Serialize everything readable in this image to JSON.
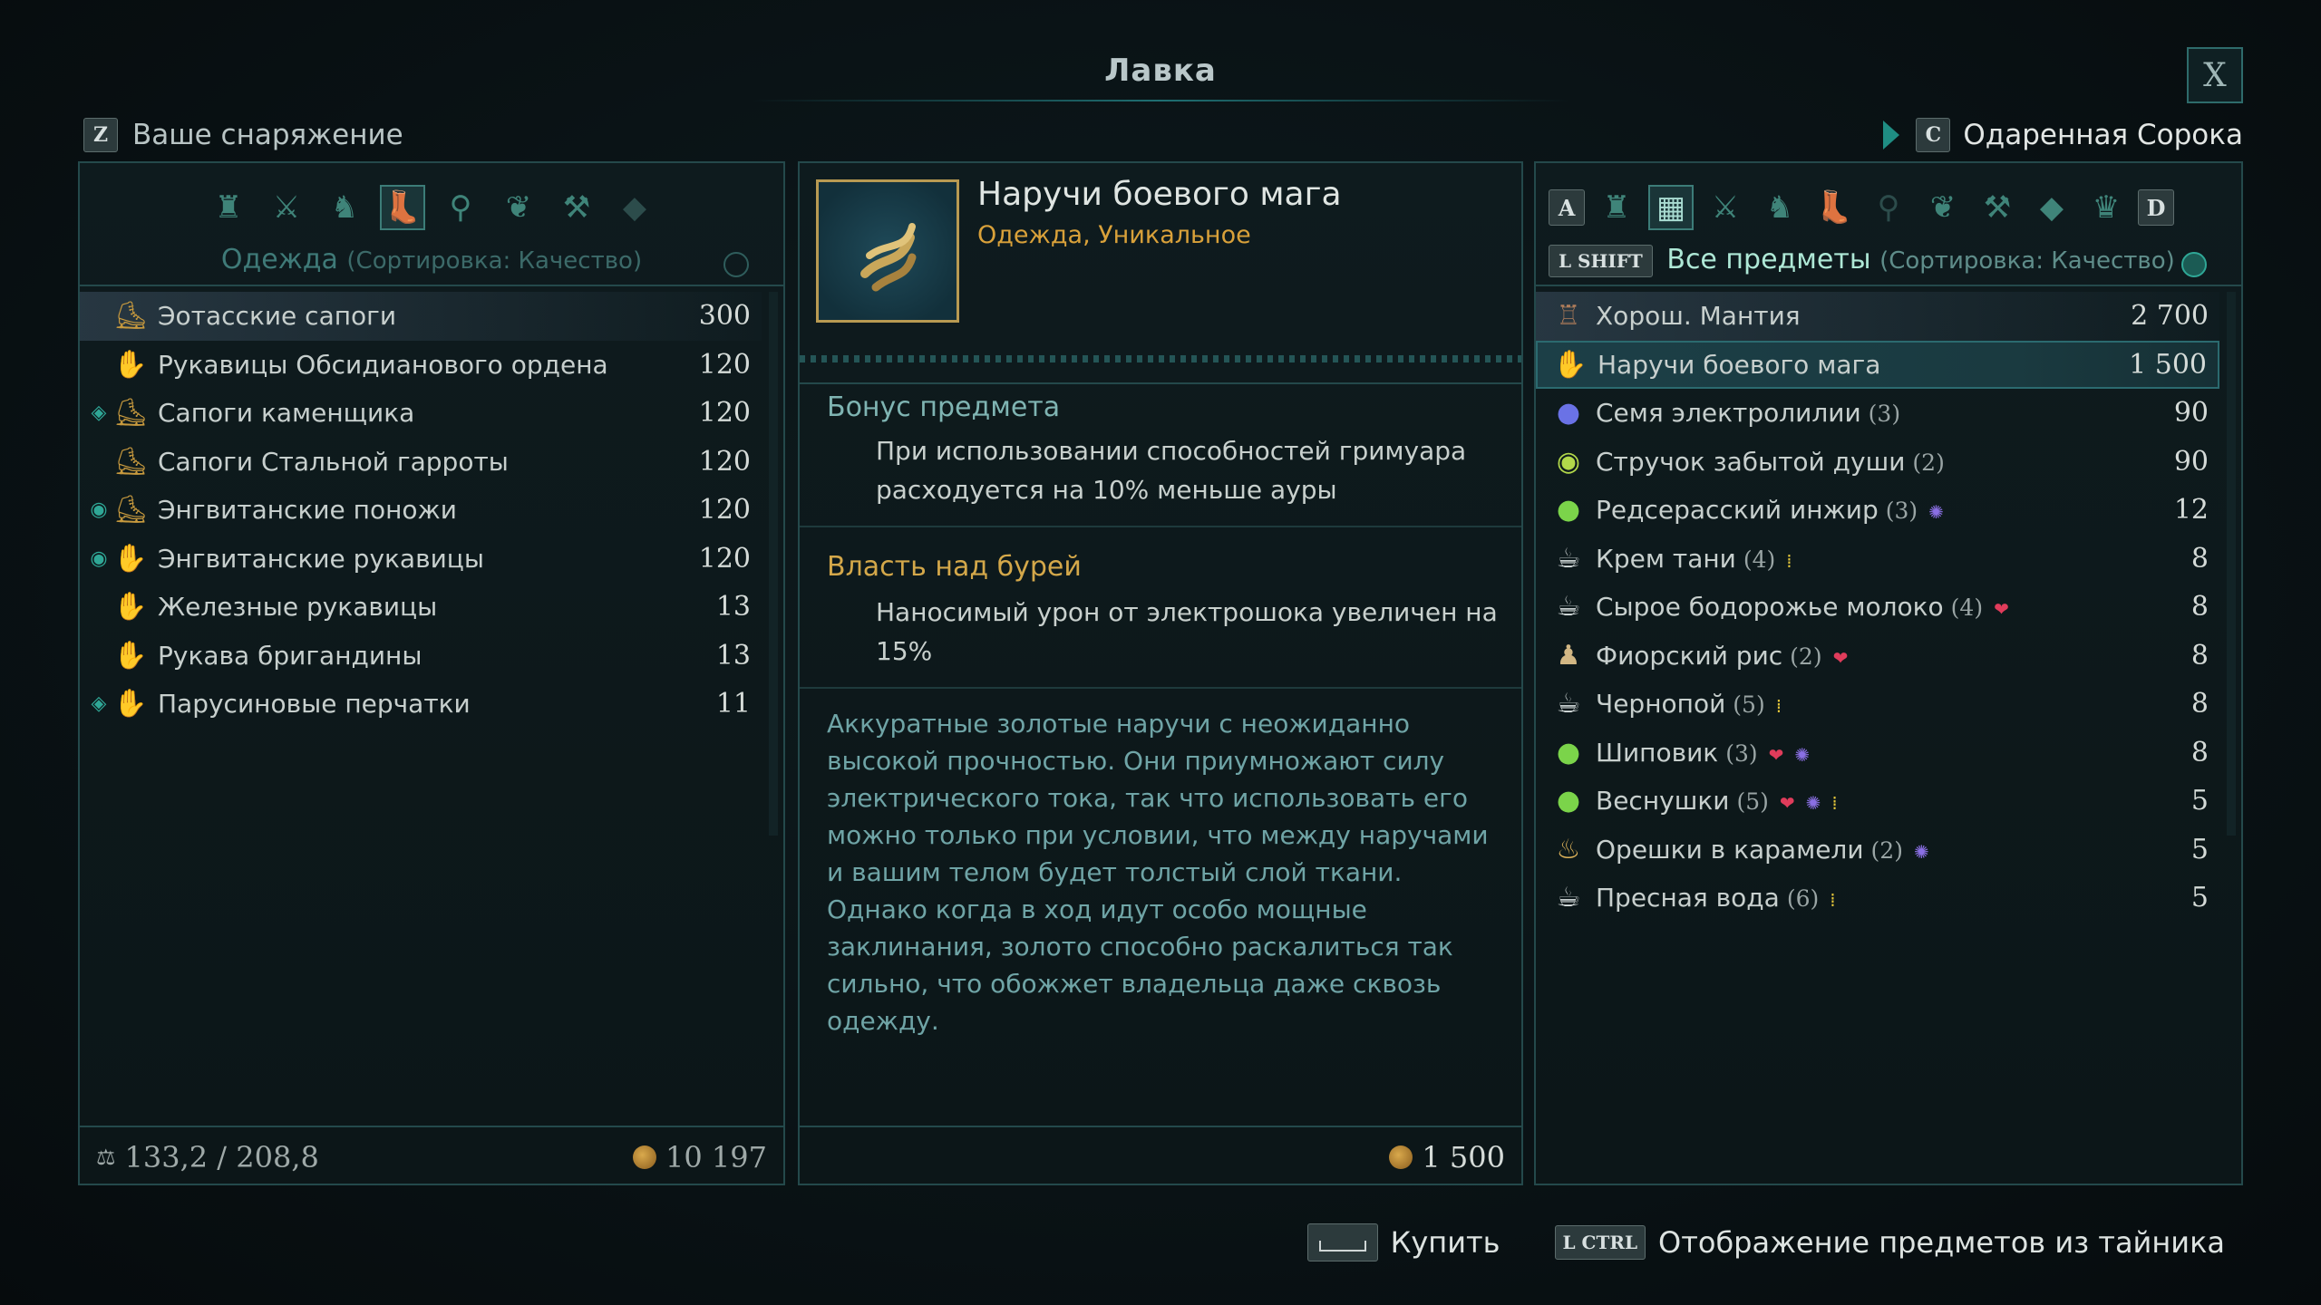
{
  "title": "Лавка",
  "close_label": "X",
  "left": {
    "key": "Z",
    "title": "Ваше снаряжение",
    "category": "Одежда",
    "sort": "(Сортировка: Качество)",
    "items": [
      {
        "name": "Эотасские сапоги",
        "price": "300",
        "icon": "boots-icon",
        "mark": ""
      },
      {
        "name": "Рукавицы Обсидианового ордена",
        "price": "120",
        "icon": "gloves-icon",
        "mark": ""
      },
      {
        "name": "Сапоги каменщика",
        "price": "120",
        "icon": "boots-icon",
        "mark": "diamond"
      },
      {
        "name": "Сапоги Стальной гарроты",
        "price": "120",
        "icon": "boots-icon",
        "mark": ""
      },
      {
        "name": "Энгвитанские поножи",
        "price": "120",
        "icon": "boots-icon",
        "mark": "eye"
      },
      {
        "name": "Энгвитанские рукавицы",
        "price": "120",
        "icon": "gloves-icon",
        "mark": "eye"
      },
      {
        "name": "Железные рукавицы",
        "price": "13",
        "icon": "gloves-icon",
        "mark": ""
      },
      {
        "name": "Рукава бригандины",
        "price": "13",
        "icon": "gloves-icon",
        "mark": ""
      },
      {
        "name": "Парусиновые перчатки",
        "price": "11",
        "icon": "gloves-icon",
        "mark": "diamond"
      }
    ],
    "weight": "133,2 / 208,8",
    "money": "10 197"
  },
  "middle": {
    "item_name": "Наручи боевого мага",
    "item_type": "Одежда, Уникальное",
    "bonus_title": "Бонус предмета",
    "bonus_text": "При использовании способностей гримуара расходуется на 10% меньше ауры",
    "ability_title": "Власть над бурей",
    "ability_text": "Наносимый урон от электрошока увеличен на 15%",
    "description": "Аккуратные золотые наручи с неожиданно высокой прочностью. Они приумножают силу электрического тока, так что использовать его можно только при условии, что между наручами и вашим телом будет толстый слой ткани. Однако когда в ход идут особо мощные заклинания, золото способно раскалиться так сильно, что обожжет владельца даже сквозь одежду.",
    "price": "1 500"
  },
  "right": {
    "key": "C",
    "title": "Одаренная Сорока",
    "left_key": "A",
    "right_key": "D",
    "shift_key": "L SHIFT",
    "category": "Все предметы",
    "sort": "(Сортировка: Качество)",
    "items": [
      {
        "name": "Хорош. Мантия",
        "qty": "",
        "price": "2 700",
        "icon": "robe-icon",
        "effects": []
      },
      {
        "name": "Наручи боевого мага",
        "qty": "",
        "price": "1 500",
        "icon": "gloves-icon",
        "effects": []
      },
      {
        "name": "Семя электролилии",
        "qty": "(3)",
        "price": "90",
        "icon": "seed-icon",
        "effects": []
      },
      {
        "name": "Стручок забытой души",
        "qty": "(2)",
        "price": "90",
        "icon": "pod-icon",
        "effects": []
      },
      {
        "name": "Редсерасский инжир",
        "qty": "(3)",
        "price": "12",
        "icon": "fruit-icon",
        "effects": [
          "swirl"
        ]
      },
      {
        "name": "Крем тани",
        "qty": "(4)",
        "price": "8",
        "icon": "cup-icon",
        "effects": [
          "grain"
        ]
      },
      {
        "name": "Сырое бодорожье молоко",
        "qty": "(4)",
        "price": "8",
        "icon": "cup-icon",
        "effects": [
          "heart"
        ]
      },
      {
        "name": "Фиорский рис",
        "qty": "(2)",
        "price": "8",
        "icon": "sack-icon",
        "effects": [
          "heart"
        ]
      },
      {
        "name": "Чернопой",
        "qty": "(5)",
        "price": "8",
        "icon": "cup-icon",
        "effects": [
          "grain"
        ]
      },
      {
        "name": "Шиповик",
        "qty": "(3)",
        "price": "8",
        "icon": "fruit-icon",
        "effects": [
          "heart",
          "swirl"
        ]
      },
      {
        "name": "Веснушки",
        "qty": "(5)",
        "price": "5",
        "icon": "fruit-icon",
        "effects": [
          "heart",
          "swirl",
          "grain"
        ]
      },
      {
        "name": "Орешки в карамели",
        "qty": "(2)",
        "price": "5",
        "icon": "bowl-icon",
        "effects": [
          "swirl"
        ]
      },
      {
        "name": "Пресная вода",
        "qty": "(6)",
        "price": "5",
        "icon": "cup-icon",
        "effects": [
          "grain"
        ]
      }
    ]
  },
  "actions": {
    "buy_label": "Купить",
    "ctrl_key": "L CTRL",
    "stash_label": "Отображение предметов из тайника"
  },
  "colors": {
    "accent": "#2fa796",
    "gold": "#d9a13a",
    "panel_border": "#24494b"
  }
}
